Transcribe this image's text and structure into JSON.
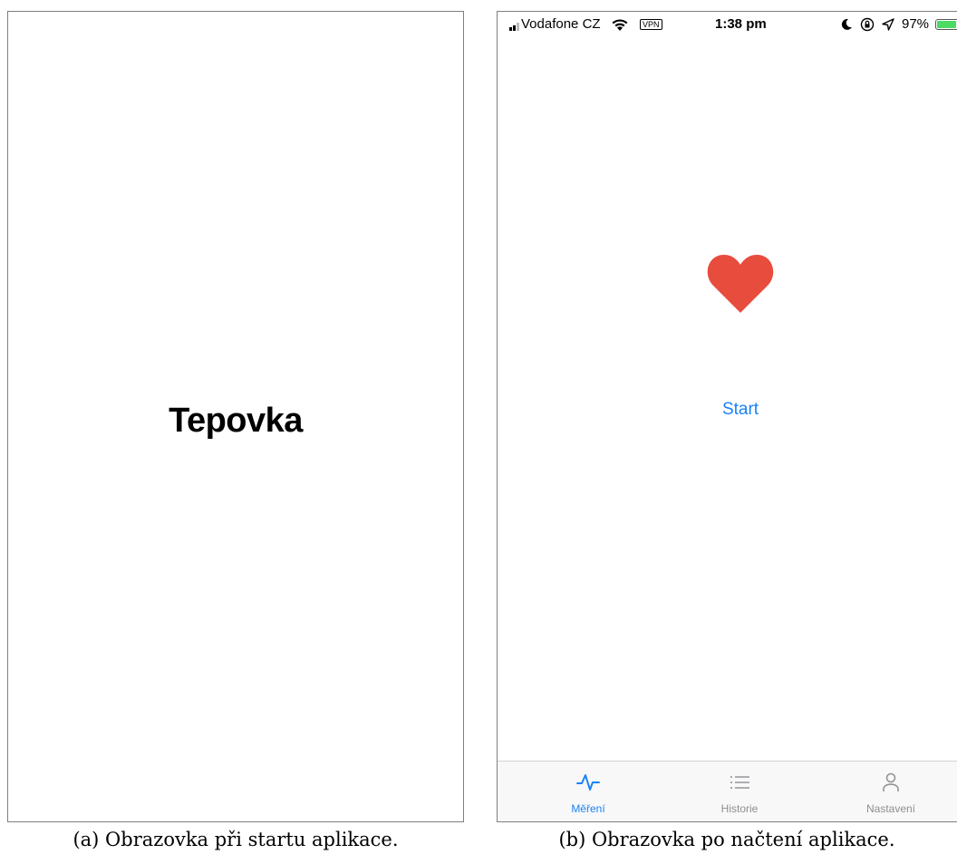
{
  "screen_a": {
    "title": "Tepovka"
  },
  "screen_b": {
    "status_bar": {
      "carrier": "Vodafone CZ",
      "vpn": "VPN",
      "time": "1:38 pm",
      "battery": "97%"
    },
    "battery_level": 0.97,
    "heart_color": "#e74c3c",
    "accent_color": "#1a82f5",
    "start_label": "Start",
    "tabs": [
      {
        "label": "Měření",
        "icon": "pulse-icon",
        "active": true
      },
      {
        "label": "Historie",
        "icon": "list-icon",
        "active": false
      },
      {
        "label": "Nastavení",
        "icon": "person-icon",
        "active": false
      }
    ]
  },
  "captions": {
    "a": "(a) Obrazovka při startu aplikace.",
    "b": "(b) Obrazovka po načtení aplikace."
  }
}
